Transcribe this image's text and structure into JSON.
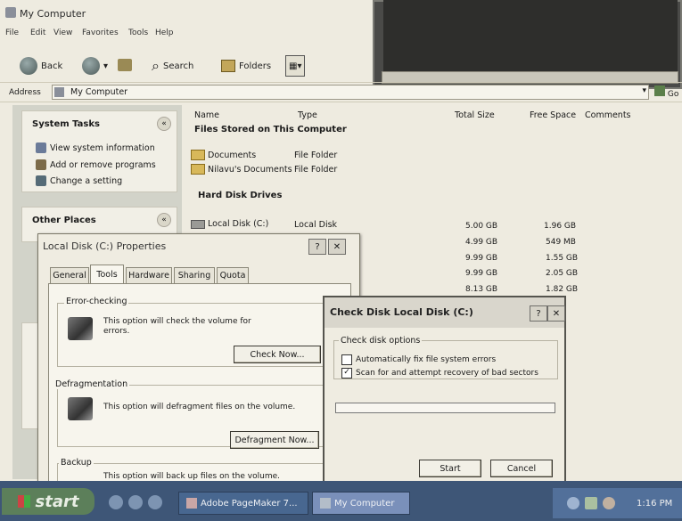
{
  "explorer": {
    "title": "My Computer",
    "menu": [
      "File",
      "Edit",
      "View",
      "Favorites",
      "Tools",
      "Help"
    ],
    "toolbar": {
      "back": "Back",
      "search": "Search",
      "folders": "Folders"
    },
    "address_label": "Address",
    "address_value": "My Computer",
    "go": "Go"
  },
  "left_pane": {
    "system_tasks": {
      "title": "System Tasks",
      "items": [
        "View system information",
        "Add or remove programs",
        "Change a setting"
      ]
    },
    "other_places": {
      "title": "Other Places"
    }
  },
  "list": {
    "columns": [
      "Name",
      "Type",
      "Total Size",
      "Free Space",
      "Comments"
    ],
    "files_group": "Files Stored on This Computer",
    "files": [
      {
        "name": "Documents",
        "type": "File Folder"
      },
      {
        "name": "Nilavu's Documents",
        "type": "File Folder"
      }
    ],
    "drives_group": "Hard Disk Drives",
    "drives": [
      {
        "name": "Local Disk (C:)",
        "type": "Local Disk",
        "total": "5.00 GB",
        "free": "1.96 GB"
      }
    ],
    "extra_sizes": [
      {
        "total": "4.99 GB",
        "free": "549 MB"
      },
      {
        "total": "9.99 GB",
        "free": "1.55 GB"
      },
      {
        "total": "9.99 GB",
        "free": "2.05 GB"
      },
      {
        "total": "8.13 GB",
        "free": "1.82 GB"
      }
    ]
  },
  "properties": {
    "title": "Local Disk (C:) Properties",
    "tabs": [
      "General",
      "Tools",
      "Hardware",
      "Sharing",
      "Quota"
    ],
    "error_checking": {
      "label": "Error-checking",
      "text": "This option will check the volume for errors.",
      "button": "Check Now..."
    },
    "defrag": {
      "label": "Defragmentation",
      "text": "This option will defragment files on the volume.",
      "button": "Defragment Now..."
    },
    "backup": {
      "label": "Backup",
      "text": "This option will back up files on the volume."
    }
  },
  "check_disk": {
    "title": "Check Disk Local Disk (C:)",
    "options_label": "Check disk options",
    "options": [
      {
        "label": "Automatically fix file system errors",
        "checked": false
      },
      {
        "label": "Scan for and attempt recovery of bad sectors",
        "checked": true
      }
    ],
    "start": "Start",
    "cancel": "Cancel"
  },
  "taskbar": {
    "start": "start",
    "tasks": [
      "Adobe PageMaker 7...",
      "My Computer"
    ],
    "clock": "1:16 PM"
  }
}
